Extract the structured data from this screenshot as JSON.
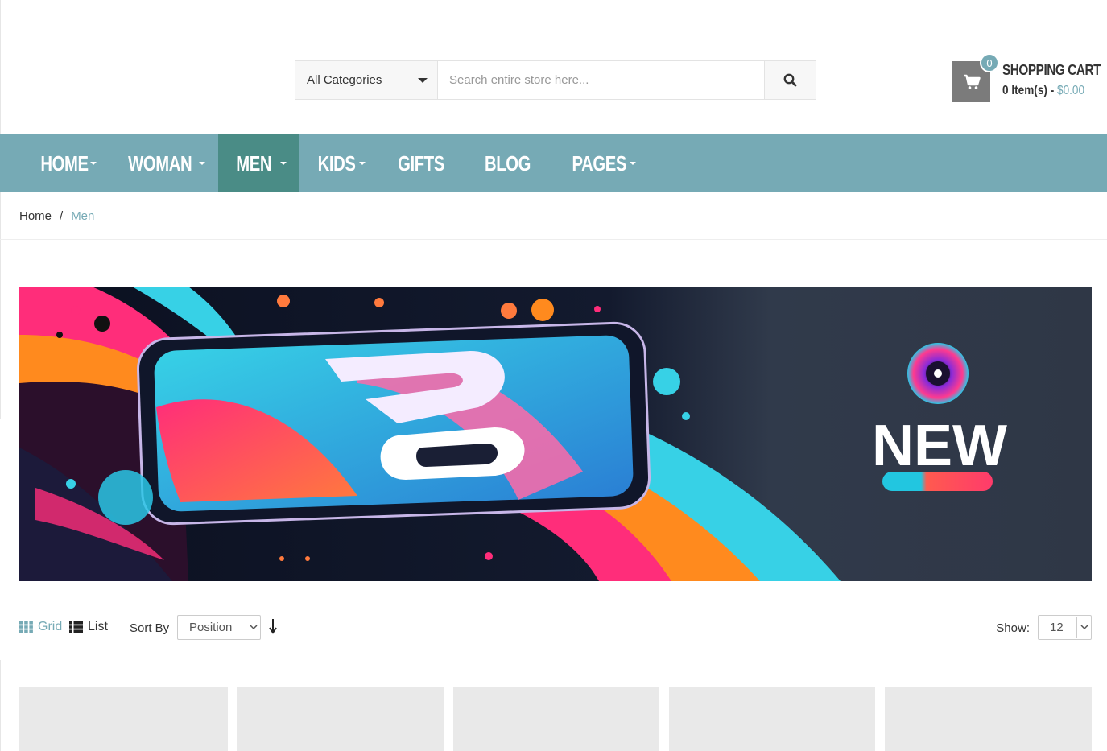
{
  "search": {
    "category_selected": "All Categories",
    "placeholder": "Search entire store here...",
    "value": ""
  },
  "cart": {
    "count": "0",
    "title": "SHOPPING CART",
    "items_text": "0 Item(s) - ",
    "total": "$0.00"
  },
  "nav": {
    "items": [
      {
        "label": "HOME",
        "has_dropdown": true
      },
      {
        "label": "WOMAN",
        "has_dropdown": true
      },
      {
        "label": "MEN",
        "has_dropdown": true,
        "active": true
      },
      {
        "label": "KIDS",
        "has_dropdown": true
      },
      {
        "label": "GIFTS",
        "has_dropdown": false
      },
      {
        "label": "BLOG",
        "has_dropdown": false
      },
      {
        "label": "PAGES",
        "has_dropdown": true
      }
    ]
  },
  "breadcrumb": {
    "home": "Home",
    "separator": "/",
    "current": "Men"
  },
  "banner": {
    "headline": "NEW"
  },
  "toolbar": {
    "grid_label": "Grid",
    "list_label": "List",
    "sort_label": "Sort By",
    "sort_value": "Position",
    "show_label": "Show:",
    "show_value": "12"
  },
  "colors": {
    "accent": "#76aab5",
    "nav_active": "#4a8c86",
    "cart_box": "#7b7b7b"
  },
  "icons": {
    "search": "search-icon",
    "cart": "shopping-cart-icon",
    "grid": "grid-icon",
    "list": "list-icon",
    "sort_direction": "arrow-down-icon"
  }
}
